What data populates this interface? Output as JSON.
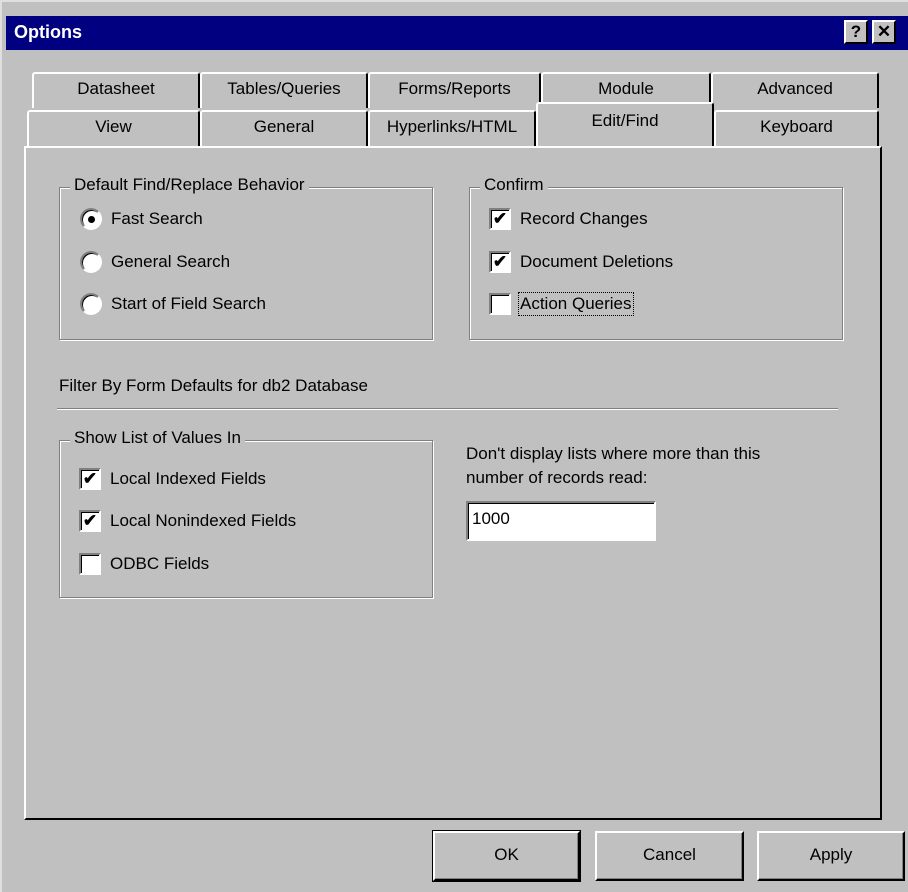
{
  "window": {
    "title": "Options",
    "help_button": "?",
    "close_button": "✕"
  },
  "tabs": {
    "row1": [
      "Datasheet",
      "Tables/Queries",
      "Forms/Reports",
      "Module",
      "Advanced"
    ],
    "row2": [
      "View",
      "General",
      "Hyperlinks/HTML",
      "Edit/Find",
      "Keyboard"
    ],
    "active": "Edit/Find"
  },
  "find_replace": {
    "legend": "Default Find/Replace Behavior",
    "options": [
      {
        "label": "Fast Search",
        "selected": true
      },
      {
        "label": "General Search",
        "selected": false
      },
      {
        "label": "Start of Field Search",
        "selected": false
      }
    ]
  },
  "confirm": {
    "legend": "Confirm",
    "options": [
      {
        "label": "Record Changes",
        "checked": true,
        "mark": "✔"
      },
      {
        "label": "Document Deletions",
        "checked": true,
        "mark": "✔"
      },
      {
        "label": "Action Queries",
        "checked": false,
        "mark": ""
      }
    ]
  },
  "filter_by_form": {
    "heading": "Filter By Form Defaults for db2 Database"
  },
  "show_list": {
    "legend": "Show List of Values In",
    "options": [
      {
        "label": "Local Indexed Fields",
        "checked": true,
        "mark": "✔"
      },
      {
        "label": "Local Nonindexed Fields",
        "checked": true,
        "mark": "✔"
      },
      {
        "label": "ODBC Fields",
        "checked": false,
        "mark": ""
      }
    ]
  },
  "records_limit": {
    "label_line1": "Don't display lists where more than this",
    "label_line2": "number of records read:",
    "value": "1000"
  },
  "buttons": {
    "ok": "OK",
    "cancel": "Cancel",
    "apply": "Apply"
  }
}
